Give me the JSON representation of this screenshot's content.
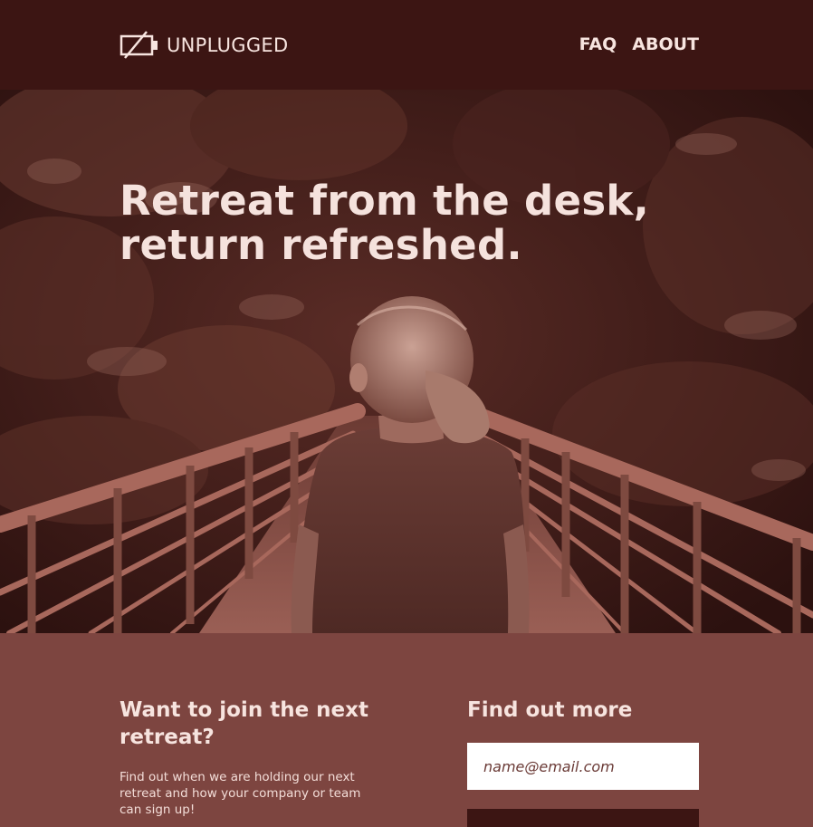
{
  "header": {
    "logo_text": "UNPLUGGED",
    "logo_icon": "battery-slash-icon",
    "nav": [
      {
        "label": "FAQ"
      },
      {
        "label": "ABOUT"
      }
    ]
  },
  "hero": {
    "headline": "Retreat from the desk, return refreshed."
  },
  "signup": {
    "join_title": "Want to join the next retreat?",
    "join_description": "Find out when we are holding our next retreat and how your company or team can sign up!",
    "more_title": "Find out more",
    "email_placeholder": "name@email.com"
  },
  "colors": {
    "header_bg": "#3c1513",
    "section_bg": "#7d4540",
    "text_light": "#f7e4df",
    "button_dark": "#3c1513"
  }
}
